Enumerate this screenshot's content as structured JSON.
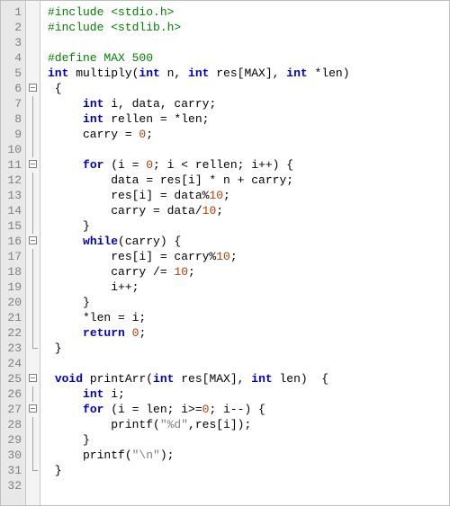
{
  "editor": {
    "lines": [
      {
        "num": "1",
        "fold": "",
        "tokens": [
          [
            "pp",
            "#include <stdio.h>"
          ]
        ]
      },
      {
        "num": "2",
        "fold": "",
        "tokens": [
          [
            "pp",
            "#include <stdlib.h>"
          ]
        ]
      },
      {
        "num": "3",
        "fold": "",
        "tokens": []
      },
      {
        "num": "4",
        "fold": "",
        "tokens": [
          [
            "pp",
            "#define MAX 500"
          ]
        ]
      },
      {
        "num": "5",
        "fold": "",
        "tokens": [
          [
            "kw",
            "int"
          ],
          [
            "id",
            " multiply("
          ],
          [
            "kw",
            "int"
          ],
          [
            "id",
            " n, "
          ],
          [
            "kw",
            "int"
          ],
          [
            "id",
            " res[MAX], "
          ],
          [
            "kw",
            "int"
          ],
          [
            "id",
            " *len)"
          ]
        ]
      },
      {
        "num": "6",
        "fold": "box",
        "tokens": [
          [
            "id",
            " {"
          ]
        ]
      },
      {
        "num": "7",
        "fold": "vert",
        "tokens": [
          [
            "id",
            "     "
          ],
          [
            "kw",
            "int"
          ],
          [
            "id",
            " i, data, carry;"
          ]
        ]
      },
      {
        "num": "8",
        "fold": "vert",
        "tokens": [
          [
            "id",
            "     "
          ],
          [
            "kw",
            "int"
          ],
          [
            "id",
            " rellen = *len;"
          ]
        ]
      },
      {
        "num": "9",
        "fold": "vert",
        "tokens": [
          [
            "id",
            "     carry = "
          ],
          [
            "num",
            "0"
          ],
          [
            "id",
            ";"
          ]
        ]
      },
      {
        "num": "10",
        "fold": "vert",
        "tokens": []
      },
      {
        "num": "11",
        "fold": "box",
        "tokens": [
          [
            "id",
            "     "
          ],
          [
            "kw",
            "for"
          ],
          [
            "id",
            " (i = "
          ],
          [
            "num",
            "0"
          ],
          [
            "id",
            "; i < rellen; i++) {"
          ]
        ]
      },
      {
        "num": "12",
        "fold": "vert",
        "tokens": [
          [
            "id",
            "         data = res[i] * n + carry;"
          ]
        ]
      },
      {
        "num": "13",
        "fold": "vert",
        "tokens": [
          [
            "id",
            "         res[i] = data%"
          ],
          [
            "num",
            "10"
          ],
          [
            "id",
            ";"
          ]
        ]
      },
      {
        "num": "14",
        "fold": "vert",
        "tokens": [
          [
            "id",
            "         carry = data/"
          ],
          [
            "num",
            "10"
          ],
          [
            "id",
            ";"
          ]
        ]
      },
      {
        "num": "15",
        "fold": "vert",
        "tokens": [
          [
            "id",
            "     }"
          ]
        ]
      },
      {
        "num": "16",
        "fold": "box",
        "tokens": [
          [
            "id",
            "     "
          ],
          [
            "kw",
            "while"
          ],
          [
            "id",
            "(carry) {"
          ]
        ]
      },
      {
        "num": "17",
        "fold": "vert",
        "tokens": [
          [
            "id",
            "         res[i] = carry%"
          ],
          [
            "num",
            "10"
          ],
          [
            "id",
            ";"
          ]
        ]
      },
      {
        "num": "18",
        "fold": "vert",
        "tokens": [
          [
            "id",
            "         carry /= "
          ],
          [
            "num",
            "10"
          ],
          [
            "id",
            ";"
          ]
        ]
      },
      {
        "num": "19",
        "fold": "vert",
        "tokens": [
          [
            "id",
            "         i++;"
          ]
        ]
      },
      {
        "num": "20",
        "fold": "vert",
        "tokens": [
          [
            "id",
            "     }"
          ]
        ]
      },
      {
        "num": "21",
        "fold": "vert",
        "tokens": [
          [
            "id",
            "     *len = i;"
          ]
        ]
      },
      {
        "num": "22",
        "fold": "vert",
        "tokens": [
          [
            "id",
            "     "
          ],
          [
            "kw",
            "return"
          ],
          [
            "id",
            " "
          ],
          [
            "num",
            "0"
          ],
          [
            "id",
            ";"
          ]
        ]
      },
      {
        "num": "23",
        "fold": "end",
        "tokens": [
          [
            "id",
            " }"
          ]
        ]
      },
      {
        "num": "24",
        "fold": "",
        "tokens": []
      },
      {
        "num": "25",
        "fold": "box",
        "tokens": [
          [
            "id",
            " "
          ],
          [
            "kw",
            "void"
          ],
          [
            "id",
            " printArr("
          ],
          [
            "kw",
            "int"
          ],
          [
            "id",
            " res[MAX], "
          ],
          [
            "kw",
            "int"
          ],
          [
            "id",
            " len)  {"
          ]
        ]
      },
      {
        "num": "26",
        "fold": "vert",
        "tokens": [
          [
            "id",
            "     "
          ],
          [
            "kw",
            "int"
          ],
          [
            "id",
            " i;"
          ]
        ]
      },
      {
        "num": "27",
        "fold": "box",
        "tokens": [
          [
            "id",
            "     "
          ],
          [
            "kw",
            "for"
          ],
          [
            "id",
            " (i = len; i>="
          ],
          [
            "num",
            "0"
          ],
          [
            "id",
            "; i--) {"
          ]
        ]
      },
      {
        "num": "28",
        "fold": "vert",
        "tokens": [
          [
            "id",
            "         printf("
          ],
          [
            "str",
            "\"%d\""
          ],
          [
            "id",
            ",res[i]);"
          ]
        ]
      },
      {
        "num": "29",
        "fold": "vert",
        "tokens": [
          [
            "id",
            "     }"
          ]
        ]
      },
      {
        "num": "30",
        "fold": "vert",
        "tokens": [
          [
            "id",
            "     printf("
          ],
          [
            "str",
            "\"\\n\""
          ],
          [
            "id",
            ");"
          ]
        ]
      },
      {
        "num": "31",
        "fold": "end",
        "tokens": [
          [
            "id",
            " }"
          ]
        ]
      },
      {
        "num": "32",
        "fold": "",
        "tokens": []
      }
    ]
  }
}
